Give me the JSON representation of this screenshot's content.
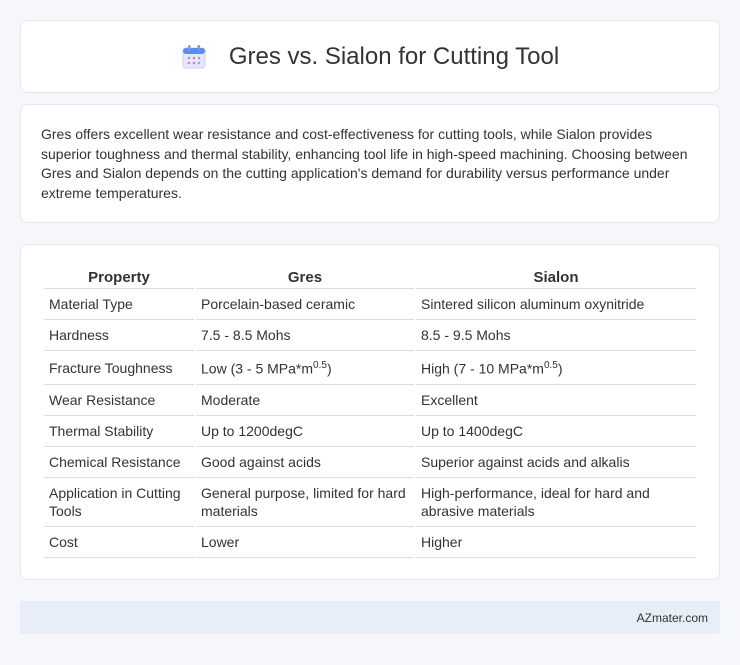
{
  "header": {
    "title": "Gres vs. Sialon for Cutting Tool",
    "icon": "calendar-icon"
  },
  "summary": {
    "text": "Gres offers excellent wear resistance and cost-effectiveness for cutting tools, while Sialon provides superior toughness and thermal stability, enhancing tool life in high-speed machining. Choosing between Gres and Sialon depends on the cutting application's demand for durability versus performance under extreme temperatures."
  },
  "table": {
    "headers": [
      "Property",
      "Gres",
      "Sialon"
    ],
    "rows": [
      [
        "Material Type",
        "Porcelain-based ceramic",
        "Sintered silicon aluminum oxynitride"
      ],
      [
        "Hardness",
        "7.5 - 8.5 Mohs",
        "8.5 - 9.5 Mohs"
      ],
      [
        "Fracture Toughness",
        "Low (3 - 5 MPa*m",
        "High (7 - 10 MPa*m"
      ],
      [
        "Wear Resistance",
        "Moderate",
        "Excellent"
      ],
      [
        "Thermal Stability",
        "Up to 1200degC",
        "Up to 1400degC"
      ],
      [
        "Chemical Resistance",
        "Good against acids",
        "Superior against acids and alkalis"
      ],
      [
        "Application in Cutting Tools",
        "General purpose, limited for hard materials",
        "High-performance, ideal for hard and abrasive materials"
      ],
      [
        "Cost",
        "Lower",
        "Higher"
      ]
    ],
    "fracture_exponent": "0.5",
    "fracture_suffix": ")"
  },
  "footer": {
    "brand": "AZmater.com"
  }
}
